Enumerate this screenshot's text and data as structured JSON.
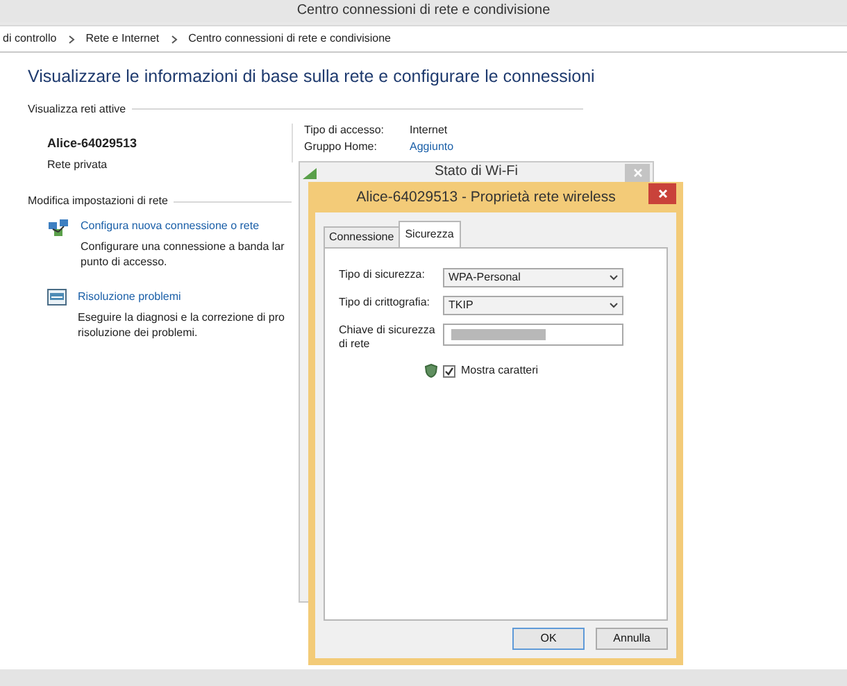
{
  "main_window": {
    "title": "Centro connessioni di rete e condivisione",
    "breadcrumb": [
      "di controllo",
      "Rete e Internet",
      "Centro connessioni di rete e condivisione"
    ],
    "heading": "Visualizzare le informazioni di base sulla rete e configurare le connessioni",
    "active_networks": {
      "section_title": "Visualizza reti attive",
      "network_name": "Alice-64029513",
      "network_type": "Rete privata",
      "details": [
        {
          "label": "Tipo di accesso:",
          "value": "Internet",
          "kind": "text"
        },
        {
          "label": "Gruppo Home:",
          "value": "Aggiunto",
          "kind": "link"
        }
      ]
    },
    "change_settings": {
      "section_title": "Modifica impostazioni di rete",
      "items": [
        {
          "kind": "setup",
          "title": "Configura nuova connessione o rete",
          "lines": [
            "Configurare una connessione a banda lar",
            "punto di accesso."
          ]
        },
        {
          "kind": "troubleshoot",
          "title": "Risoluzione problemi",
          "lines": [
            "Eseguire la diagnosi e la correzione di pro",
            "risoluzione dei problemi."
          ]
        }
      ]
    }
  },
  "status_window": {
    "title": "Stato di Wi-Fi"
  },
  "dialog": {
    "title": "Alice-64029513 - Proprietà rete wireless",
    "tabs": [
      {
        "label": "Connessione",
        "selected": false
      },
      {
        "label": "Sicurezza",
        "selected": true
      }
    ],
    "fields": [
      {
        "kind": "select",
        "label": "Tipo di sicurezza:",
        "value": "WPA-Personal"
      },
      {
        "kind": "select",
        "label": "Tipo di crittografia:",
        "value": "TKIP"
      },
      {
        "kind": "masked",
        "label": "Chiave di sicurezza di rete"
      }
    ],
    "show_characters": {
      "label": "Mostra caratteri",
      "checked": true
    },
    "buttons": [
      "OK",
      "Annulla"
    ]
  }
}
